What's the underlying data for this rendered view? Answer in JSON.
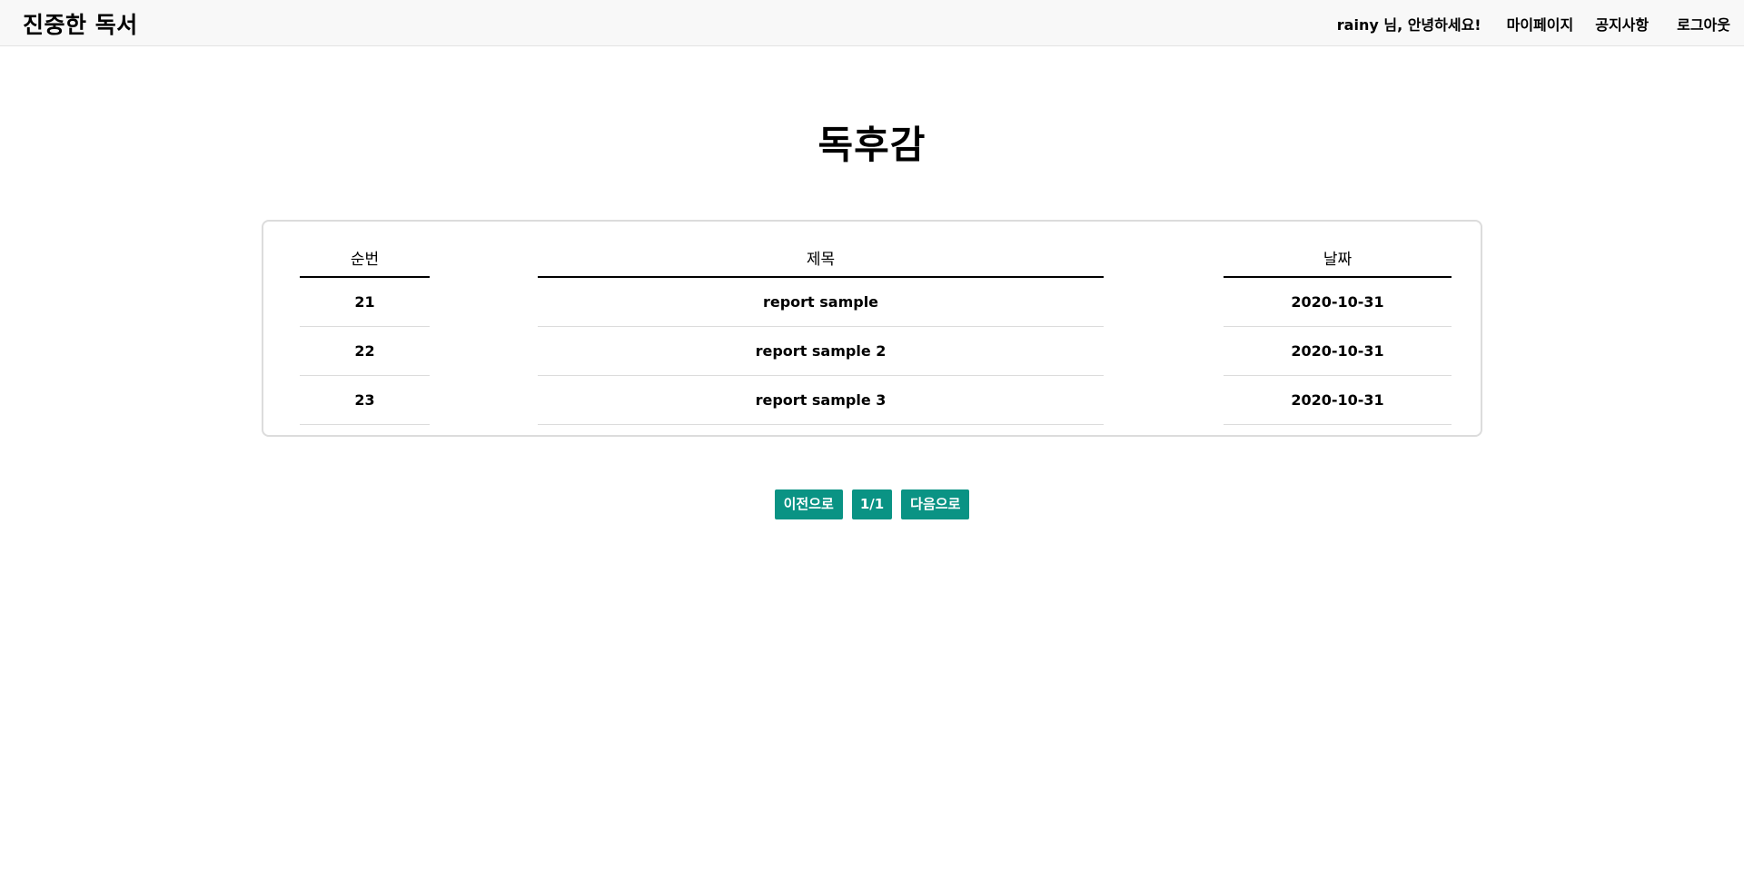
{
  "brand": "진중한 독서",
  "nav": {
    "greeting": "rainy 님, 안녕하세요!",
    "mypage": "마이페이지",
    "notice": "공지사항",
    "logout": "로그아웃"
  },
  "page": {
    "title": "독후감"
  },
  "table": {
    "headers": {
      "num": "순번",
      "title": "제목",
      "date": "날짜"
    },
    "rows": [
      {
        "num": "21",
        "title": "report sample",
        "date": "2020-10-31"
      },
      {
        "num": "22",
        "title": "report sample 2",
        "date": "2020-10-31"
      },
      {
        "num": "23",
        "title": "report sample 3",
        "date": "2020-10-31"
      }
    ]
  },
  "pagination": {
    "prev": "이전으로",
    "page": "1/1",
    "next": "다음으로"
  },
  "colors": {
    "accent": "#0a9384",
    "topbar": "#f8f8f8"
  }
}
